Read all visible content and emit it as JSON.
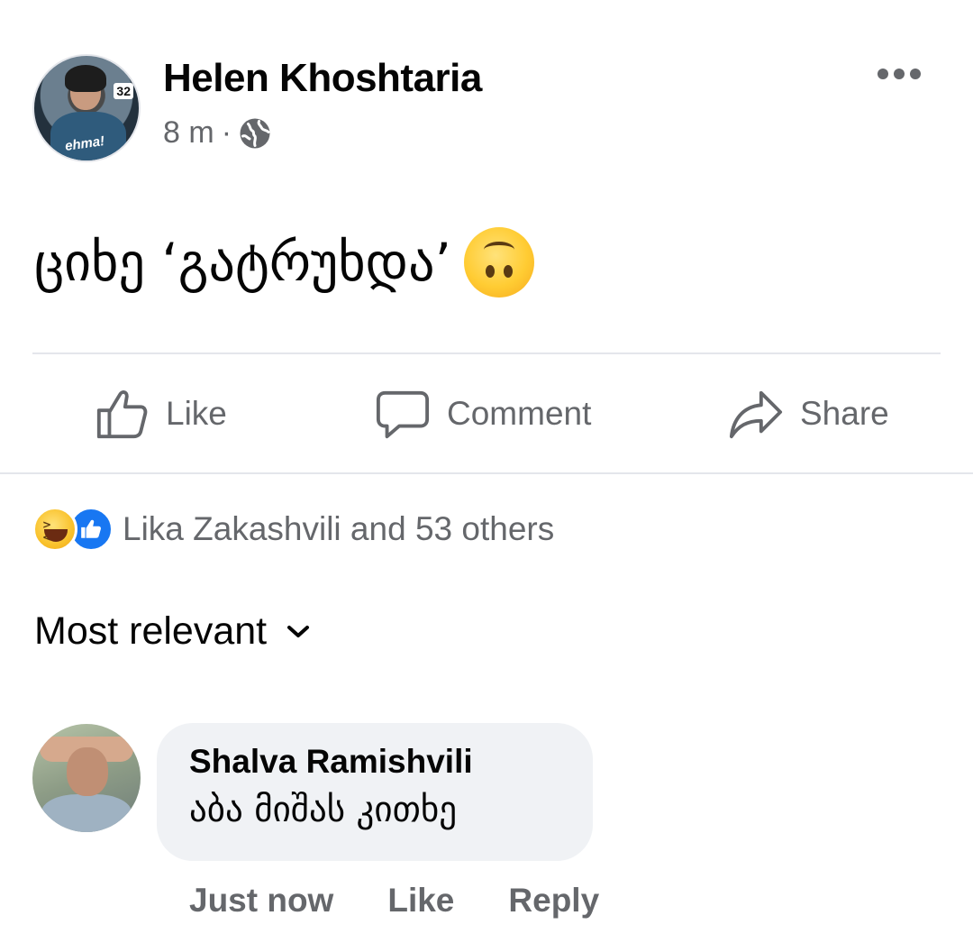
{
  "post": {
    "author": "Helen Khoshtaria",
    "time": "8 m",
    "separator": "·",
    "avatar_badge": "32",
    "avatar_logo": "ehma!",
    "text": "ციხე ‘გატრუხდა’",
    "privacy_icon": "globe-icon",
    "emoji": "upside-down-face"
  },
  "actions": {
    "like": "Like",
    "comment": "Comment",
    "share": "Share"
  },
  "reactions": {
    "summary": "Lika Zakashvili and 53 others",
    "icons": [
      "haha-icon",
      "like-icon"
    ]
  },
  "comments_section": {
    "sort_label": "Most relevant"
  },
  "comment": {
    "author": "Shalva Ramishvili",
    "text": "აბა მიშას კითხე",
    "time": "Just now",
    "like": "Like",
    "reply": "Reply"
  },
  "colors": {
    "secondary_text": "#65676b",
    "bubble": "#f0f2f5",
    "like_blue": "#1877f2",
    "divider": "#e4e6eb"
  }
}
